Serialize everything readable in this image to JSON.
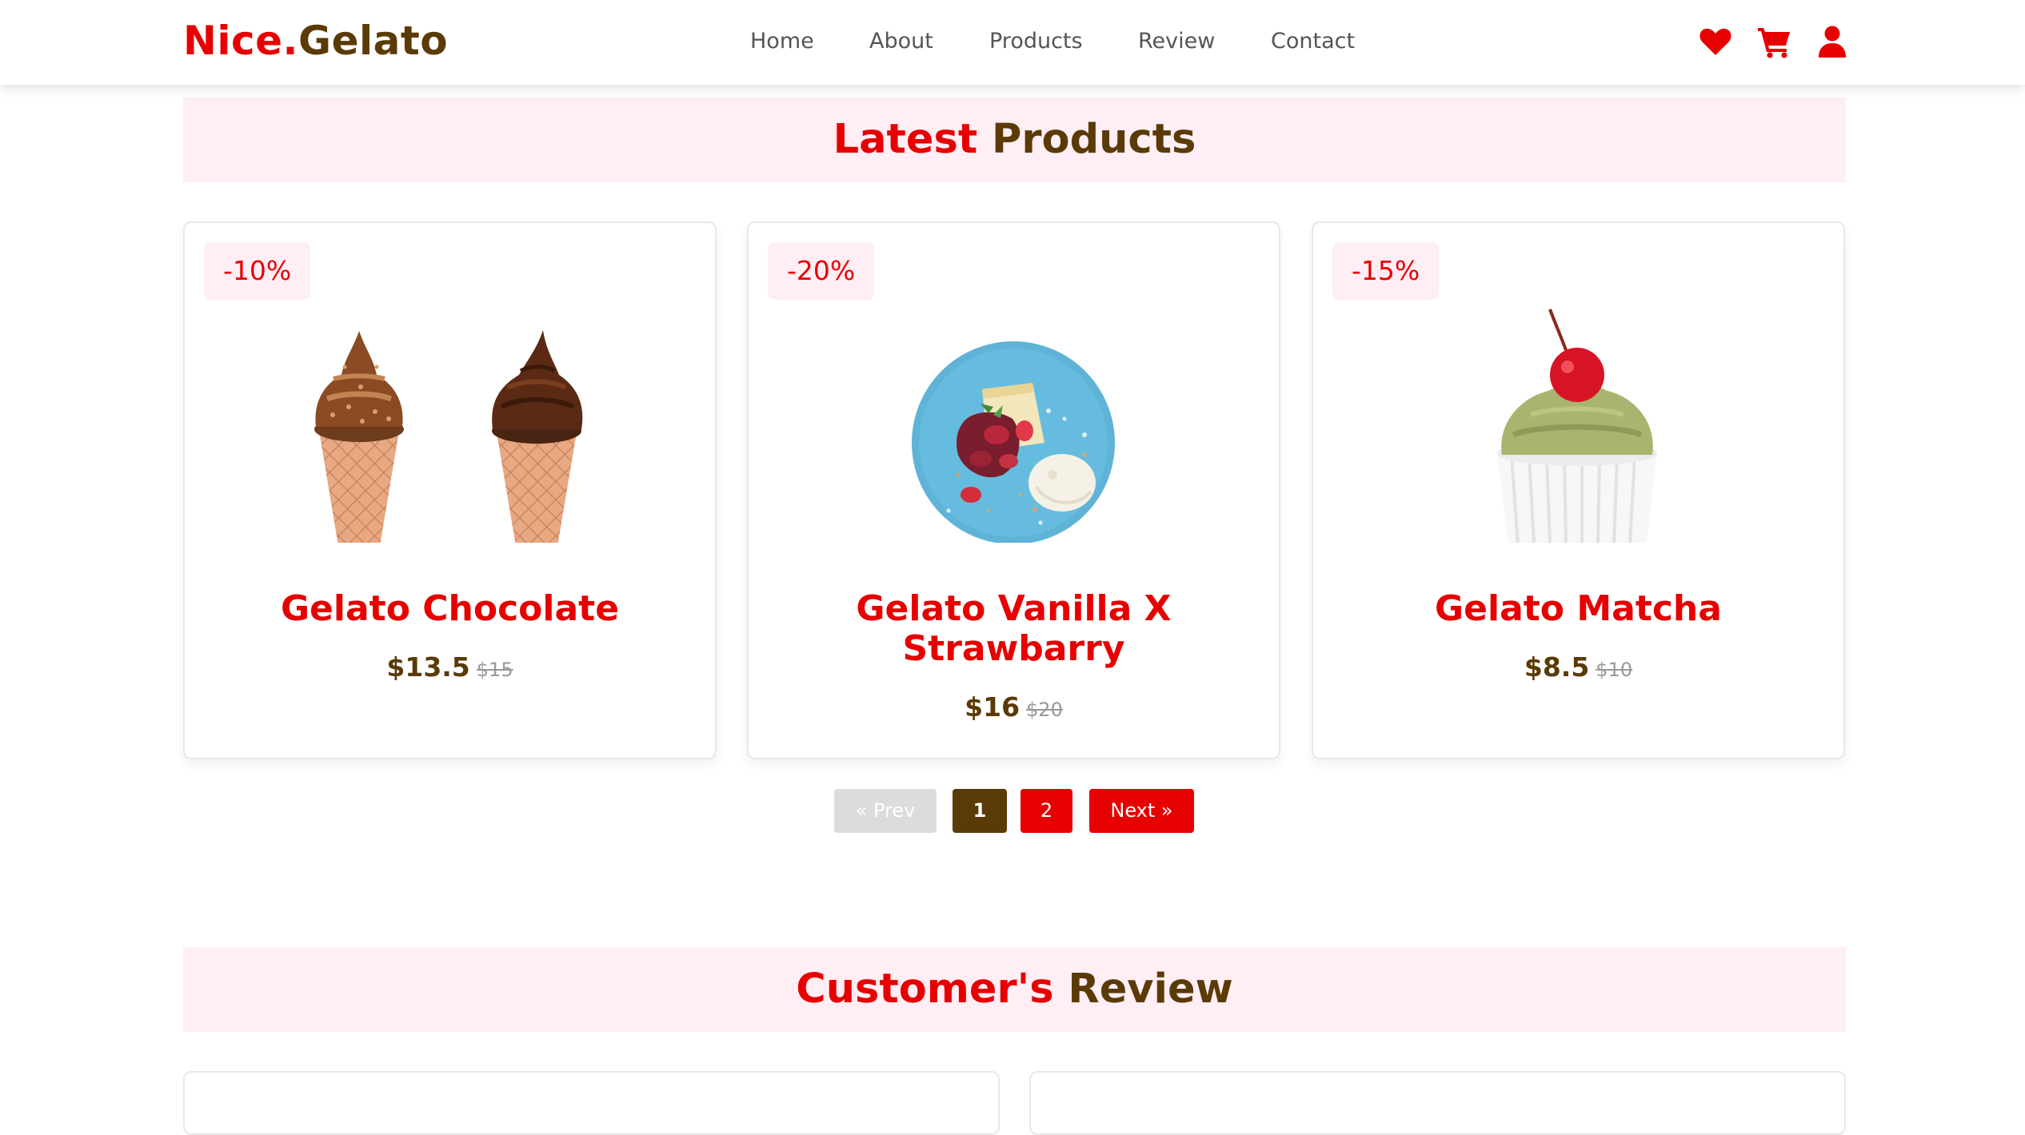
{
  "brand": {
    "part1": "Nice.",
    "part2": "Gelato"
  },
  "nav": {
    "items": [
      {
        "label": "Home"
      },
      {
        "label": "About"
      },
      {
        "label": "Products"
      },
      {
        "label": "Review"
      },
      {
        "label": "Contact"
      }
    ]
  },
  "header_icons": [
    "heart-icon",
    "cart-icon",
    "user-icon"
  ],
  "products_section": {
    "title_part1": "Latest",
    "title_part2": "Products",
    "products": [
      {
        "badge": "-10%",
        "name": "Gelato Chocolate",
        "price": "$13.5",
        "old_price": "$15",
        "image": "chocolate-cones"
      },
      {
        "badge": "-20%",
        "name": "Gelato Vanilla X Strawbarry",
        "price": "$16",
        "old_price": "$20",
        "image": "vanilla-strawberry-plate"
      },
      {
        "badge": "-15%",
        "name": "Gelato Matcha",
        "price": "$8.5",
        "old_price": "$10",
        "image": "matcha-cup-cherry"
      }
    ]
  },
  "pagination": {
    "prev": "« Prev",
    "pages": [
      "1",
      "2"
    ],
    "current": "1",
    "next": "Next »"
  },
  "review_section": {
    "title_part1": "Customer's",
    "title_part2": "Review"
  },
  "colors": {
    "brand_red": "#e60000",
    "brand_brown": "#5a3a06",
    "band_pink": "#ffeef4",
    "disabled_gray": "#dcdcdc"
  }
}
